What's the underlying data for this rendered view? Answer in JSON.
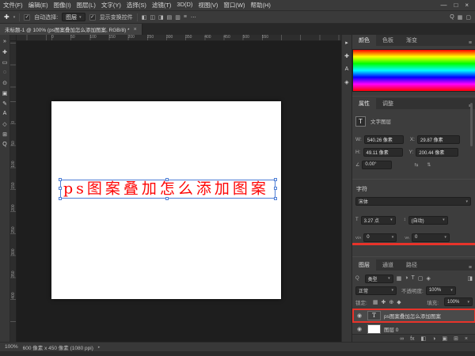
{
  "menubar": {
    "items": [
      "文件(F)",
      "编辑(E)",
      "图像(I)",
      "图层(L)",
      "文字(Y)",
      "选择(S)",
      "滤镜(T)",
      "3D(D)",
      "视图(V)",
      "窗口(W)",
      "帮助(H)"
    ],
    "controls": {
      "minimize": "—",
      "maximize": "□",
      "close": "×"
    }
  },
  "options": {
    "auto_select_label": "自动选择:",
    "auto_select_value": "图层",
    "show_controls_label": "显示变换控件",
    "more": "⋯",
    "align_icons": [
      "◧",
      "◫",
      "◨",
      "▤",
      "▥",
      "≡"
    ],
    "right_icons": [
      {
        "glyph": "Q",
        "name": "search-icon"
      },
      {
        "glyph": "▦",
        "name": "grid-view-icon"
      },
      {
        "glyph": "▢",
        "name": "workspace-icon"
      }
    ]
  },
  "tab": {
    "title": "未标题-1 @ 100% (ps图案叠加怎么添加图案, RGB/8) *"
  },
  "tools": [
    {
      "glyph": "»",
      "name": "expand-toolbar-icon"
    },
    {
      "glyph": "✚",
      "name": "move-tool-icon"
    },
    {
      "glyph": "▭",
      "name": "marquee-tool-icon"
    },
    {
      "glyph": "◌",
      "name": "lasso-tool-icon"
    },
    {
      "glyph": "⊙",
      "name": "magic-wand-tool-icon"
    },
    {
      "glyph": "▣",
      "name": "crop-tool-icon"
    },
    {
      "glyph": "✎",
      "name": "brush-tool-icon"
    },
    {
      "glyph": "A",
      "name": "type-tool-icon"
    },
    {
      "glyph": "◇",
      "name": "shape-tool-icon"
    },
    {
      "glyph": "⊞",
      "name": "hand-tool-icon"
    },
    {
      "glyph": "Q",
      "name": "zoom-tool-icon"
    }
  ],
  "dock": [
    {
      "glyph": "▸",
      "name": "expand-dock-icon"
    },
    {
      "glyph": "✚",
      "name": "history-panel-icon"
    },
    {
      "glyph": "A",
      "name": "character-panel-icon"
    },
    {
      "glyph": "◈",
      "name": "libraries-panel-icon"
    }
  ],
  "rulers": {
    "top": [
      "0",
      "50",
      "100",
      "150",
      "200",
      "250",
      "300",
      "350",
      "400",
      "450",
      "500",
      "550"
    ],
    "left": [
      "0",
      "50",
      "100",
      "150",
      "200",
      "250",
      "300",
      "350",
      "400"
    ]
  },
  "canvas": {
    "text": "ps图案叠加怎么添加图案"
  },
  "color_panel": {
    "tabs": [
      "颜色",
      "色板",
      "渐变"
    ]
  },
  "properties": {
    "tabs": [
      "属性",
      "调整"
    ],
    "layer_type": "文字图层",
    "transform": {
      "w_label": "W:",
      "w_value": "540.26 像素",
      "x_label": "X:",
      "x_value": "29.87 像素",
      "h_label": "H:",
      "h_value": "49.11 像素",
      "y_label": "Y:",
      "y_value": "200.44 像素",
      "angle_value": "0.00°"
    },
    "character": {
      "title": "字符",
      "font": "宋体",
      "size_value": "3.27 点",
      "leading_value": "(自动)",
      "kerning_value": "0",
      "tracking_value": "0"
    }
  },
  "layers_panel": {
    "tabs": [
      "图层",
      "通道",
      "路径"
    ],
    "filter_label": "类型",
    "filter_icons": [
      {
        "glyph": "▦",
        "name": "filter-pixel-layers-icon"
      },
      {
        "glyph": "◑",
        "name": "filter-adjustment-layers-icon"
      },
      {
        "glyph": "T",
        "name": "filter-type-layers-icon"
      },
      {
        "glyph": "▢",
        "name": "filter-shape-layers-icon"
      },
      {
        "glyph": "◈",
        "name": "filter-smart-objects-icon"
      }
    ],
    "blend_mode": "正常",
    "opacity_label": "不透明度:",
    "opacity": "100%",
    "lock_label": "锁定:",
    "lock_icons": [
      {
        "glyph": "▦",
        "name": "lock-transparency-icon"
      },
      {
        "glyph": "✚",
        "name": "lock-position-icon"
      },
      {
        "glyph": "⊕",
        "name": "lock-artboard-icon"
      },
      {
        "glyph": "◆",
        "name": "lock-all-icon"
      }
    ],
    "fill_label": "填充:",
    "fill": "100%",
    "layers": [
      {
        "name": "ps图案叠加怎么添加图案",
        "thumb": "T"
      },
      {
        "name": "图层 0",
        "thumb": ""
      }
    ],
    "bottom_icons": [
      {
        "glyph": "∞",
        "name": "link-layers-icon"
      },
      {
        "glyph": "fx",
        "name": "layer-style-icon"
      },
      {
        "glyph": "◧",
        "name": "layer-mask-icon"
      },
      {
        "glyph": "◑",
        "name": "adjustment-layer-icon"
      },
      {
        "glyph": "▣",
        "name": "layer-group-icon"
      },
      {
        "glyph": "⊞",
        "name": "new-layer-icon"
      },
      {
        "glyph": "×",
        "name": "delete-layer-icon"
      }
    ]
  },
  "statusbar": {
    "zoom": "100%",
    "doc_info": "600 像素 x 450 像素 (1080 ppi)"
  },
  "icons": {
    "move": "✚",
    "chevron": "▾",
    "check": "✓",
    "menu": "≡",
    "eye": "◉",
    "angle": "∠",
    "flip_h": "⇆",
    "flip_v": "⇅",
    "size": "T",
    "leading": "↕",
    "kerning": "V/A",
    "tracking": "VA",
    "search": "Q",
    "toggle": "◨",
    "arrow": "▸",
    "tab_close": "×"
  },
  "colors": {
    "canvas_text_red": "#fe0404",
    "annotation_red": "#e8332a",
    "selection_blue": "#4f7fd6"
  }
}
